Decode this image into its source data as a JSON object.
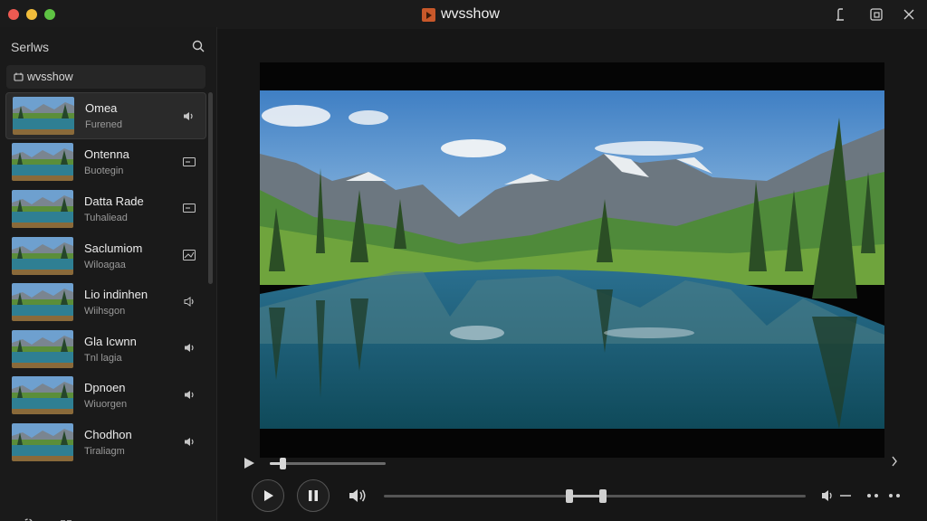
{
  "window": {
    "title": "wvsshow"
  },
  "sidebar": {
    "search_placeholder": "Serlws",
    "channel_label": "wvsshow",
    "items": [
      {
        "title": "Omea",
        "subtitle": "Furened",
        "icon": "speaker-icon",
        "selected": true
      },
      {
        "title": "Ontenna",
        "subtitle": "Buotegin",
        "icon": "caption-icon",
        "selected": false
      },
      {
        "title": "Datta Rade",
        "subtitle": "Tuhaliead",
        "icon": "caption-icon",
        "selected": false
      },
      {
        "title": "Saclumiom",
        "subtitle": "Wiloagaa",
        "icon": "image-icon",
        "selected": false
      },
      {
        "title": "Lio indinhen",
        "subtitle": "Wiihsgon",
        "icon": "speaker-outline-icon",
        "selected": false
      },
      {
        "title": "Gla Icwnn",
        "subtitle": "Tnl lagia",
        "icon": "speaker-icon",
        "selected": false
      },
      {
        "title": "Dpnoen",
        "subtitle": "Wiuorgen",
        "icon": "speaker-icon",
        "selected": false
      },
      {
        "title": "Chodhon",
        "subtitle": "Tiraliagm",
        "icon": "speaker-icon",
        "selected": false
      }
    ]
  },
  "player": {
    "seek_progress": 0.11,
    "volume_range": [
      0.44,
      0.52
    ]
  },
  "colors": {
    "background": "#161616",
    "sidebar": "#1a1a1a",
    "accent_selected": "#2a2a2a"
  }
}
